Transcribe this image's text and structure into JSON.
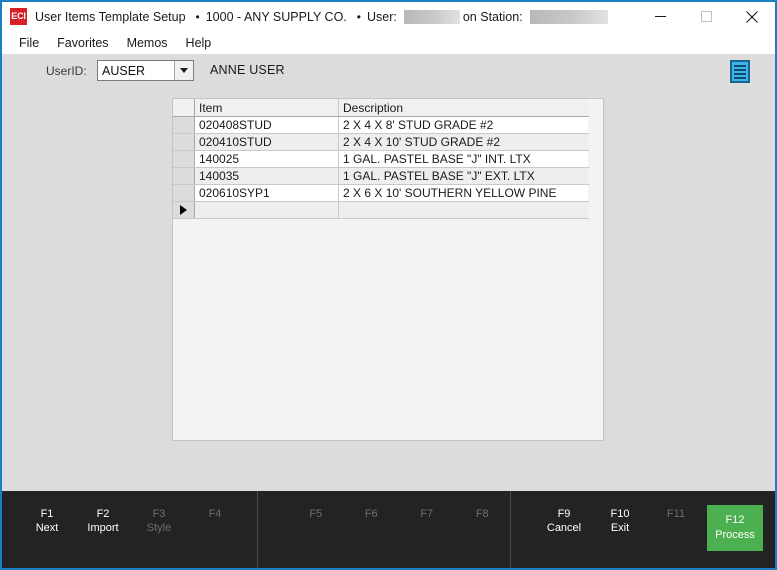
{
  "window": {
    "logo_text": "ECI",
    "title_main": "User Items Template Setup",
    "separator": "•",
    "company": "1000 - ANY SUPPLY CO.",
    "user_label": "User:",
    "station_label": "on Station:",
    "minimize_label": "minimize",
    "maximize_label": "maximize",
    "close_label": "close"
  },
  "menu": {
    "items": [
      {
        "label": "File"
      },
      {
        "label": "Favorites"
      },
      {
        "label": "Memos"
      },
      {
        "label": "Help"
      }
    ]
  },
  "form": {
    "userid_label": "UserID:",
    "userid_value": "AUSER",
    "userid_placeholder": "",
    "user_fullname": "ANNE USER",
    "notes_icon": "notes-list-icon"
  },
  "grid": {
    "columns": [
      {
        "key": "item",
        "label": "Item"
      },
      {
        "key": "description",
        "label": "Description"
      }
    ],
    "rows": [
      {
        "item": "020408STUD",
        "description": "2 X 4 X 8' STUD GRADE #2"
      },
      {
        "item": "020410STUD",
        "description": "2 X 4 X 10' STUD GRADE #2"
      },
      {
        "item": "140025",
        "description": "1 GAL. PASTEL BASE \"J\" INT. LTX"
      },
      {
        "item": "140035",
        "description": "1 GAL. PASTEL BASE \"J\" EXT. LTX"
      },
      {
        "item": "020610SYP1",
        "description": "2 X 6 X 10' SOUTHERN YELLOW PINE"
      }
    ],
    "new_row": {
      "item": "",
      "description": "",
      "indicator": "current-row-arrow"
    }
  },
  "function_bar": {
    "groups": [
      {
        "name": "group-1",
        "keys": [
          {
            "key": "F1",
            "label": "Next",
            "state": "enabled"
          },
          {
            "key": "F2",
            "label": "Import",
            "state": "enabled"
          },
          {
            "key": "F3",
            "label": "Style",
            "state": "dim"
          },
          {
            "key": "F4",
            "label": "",
            "state": "dim"
          }
        ]
      },
      {
        "name": "group-2",
        "keys": [
          {
            "key": "F5",
            "label": "",
            "state": "dim"
          },
          {
            "key": "F6",
            "label": "",
            "state": "dim"
          },
          {
            "key": "F7",
            "label": "",
            "state": "dim"
          },
          {
            "key": "F8",
            "label": "",
            "state": "dim"
          }
        ]
      },
      {
        "name": "group-3",
        "keys": [
          {
            "key": "F9",
            "label": "Cancel",
            "state": "enabled"
          },
          {
            "key": "F10",
            "label": "Exit",
            "state": "enabled"
          },
          {
            "key": "F11",
            "label": "",
            "state": "dim"
          },
          {
            "key": "F12",
            "label": "Process",
            "state": "process"
          }
        ]
      }
    ]
  },
  "colors": {
    "window_border": "#1b7fc4",
    "client_bg": "#dcdcdc",
    "panel_bg": "#f3f3f3",
    "fbar_bg": "#232323",
    "process_green": "#4caf50",
    "logo_red": "#d81f27",
    "notes_blue": "#3bb3e8"
  }
}
